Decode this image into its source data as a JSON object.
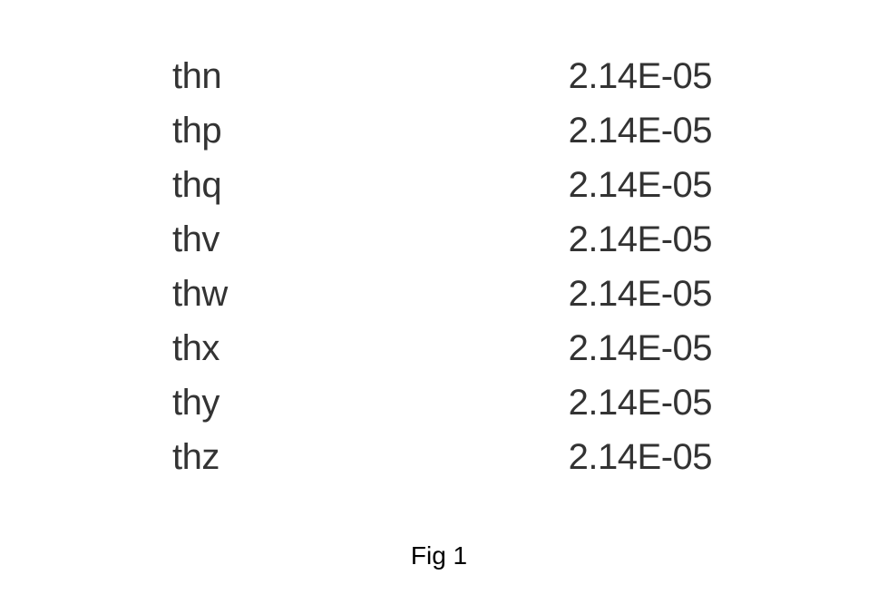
{
  "table": {
    "rows": [
      {
        "key": "thn",
        "value": "2.14E-05"
      },
      {
        "key": "thp",
        "value": "2.14E-05"
      },
      {
        "key": "thq",
        "value": "2.14E-05"
      },
      {
        "key": "thv",
        "value": "2.14E-05"
      },
      {
        "key": "thw",
        "value": "2.14E-05"
      },
      {
        "key": "thx",
        "value": "2.14E-05"
      },
      {
        "key": "thy",
        "value": "2.14E-05"
      },
      {
        "key": "thz",
        "value": "2.14E-05"
      }
    ]
  },
  "caption": "Fig 1"
}
